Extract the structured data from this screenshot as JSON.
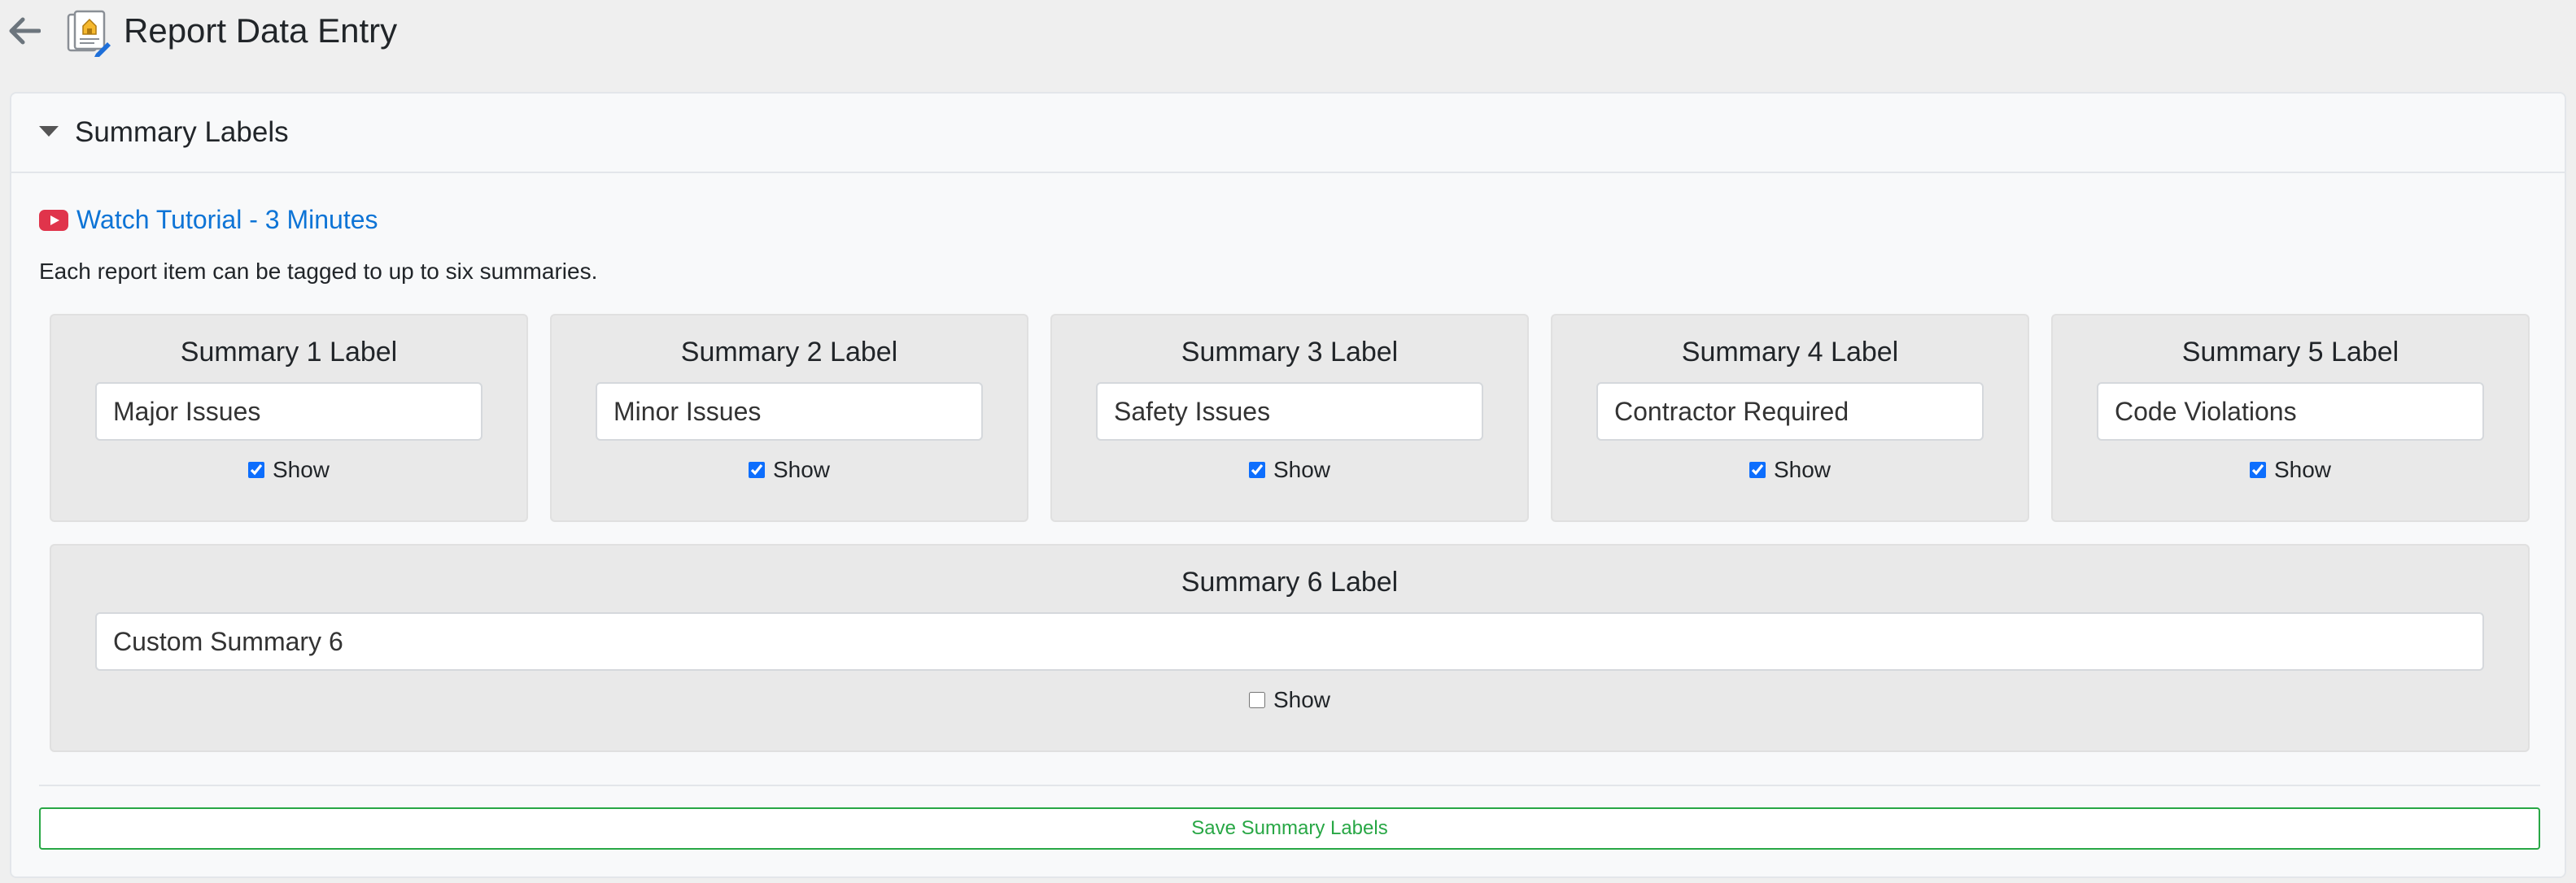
{
  "header": {
    "title": "Report Data Entry",
    "back_icon": "arrow-left-icon",
    "app_icon": "report-house-icon"
  },
  "section": {
    "title": "Summary Labels",
    "collapse_icon": "caret-down-icon"
  },
  "tutorial": {
    "icon": "youtube-icon",
    "link_text": "Watch Tutorial - 3 Minutes"
  },
  "description": "Each report item can be tagged to up to six summaries.",
  "summaries": [
    {
      "label": "Summary 1 Label",
      "value": "Major Issues",
      "show_label": "Show",
      "show": true
    },
    {
      "label": "Summary 2 Label",
      "value": "Minor Issues",
      "show_label": "Show",
      "show": true
    },
    {
      "label": "Summary 3 Label",
      "value": "Safety Issues",
      "show_label": "Show",
      "show": true
    },
    {
      "label": "Summary 4 Label",
      "value": "Contractor Required",
      "show_label": "Show",
      "show": true
    },
    {
      "label": "Summary 5 Label",
      "value": "Code Violations",
      "show_label": "Show",
      "show": true
    },
    {
      "label": "Summary 6 Label",
      "value": "Custom Summary 6",
      "show_label": "Show",
      "show": false
    }
  ],
  "save_button": "Save Summary Labels",
  "colors": {
    "link": "#0d74d6",
    "save": "#28a745",
    "youtube": "#e0344b",
    "checkbox": "#0d6efd"
  }
}
